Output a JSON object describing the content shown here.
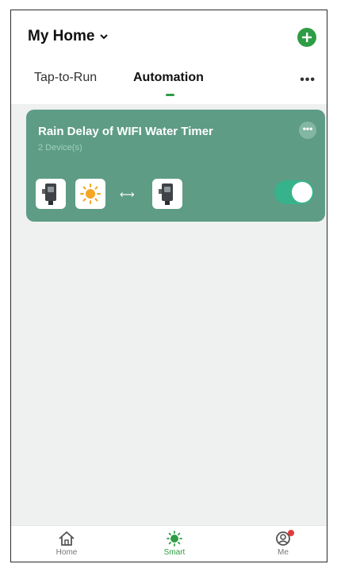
{
  "header": {
    "title": "My Home",
    "add_icon": "plus-circle-icon",
    "more_label": "•••"
  },
  "tabs": [
    {
      "label": "Tap-to-Run",
      "active": false
    },
    {
      "label": "Automation",
      "active": true
    }
  ],
  "automation": {
    "title": "Rain Delay of WIFI Water Timer",
    "subtitle": "2 Device(s)",
    "more_label": "•••",
    "flow_arrow": "⟷",
    "enabled": true,
    "tiles": [
      "water-timer-device-icon",
      "sun-weather-icon",
      "water-timer-device-icon"
    ]
  },
  "nav": [
    {
      "label": "Home",
      "icon": "home-icon",
      "active": false
    },
    {
      "label": "Smart",
      "icon": "smart-icon",
      "active": true
    },
    {
      "label": "Me",
      "icon": "profile-icon",
      "active": false,
      "badge": true
    }
  ],
  "colors": {
    "accent": "#2e9d45",
    "card": "#5e9c86",
    "toggle_on": "#37b38b",
    "badge": "#e23b3b"
  }
}
